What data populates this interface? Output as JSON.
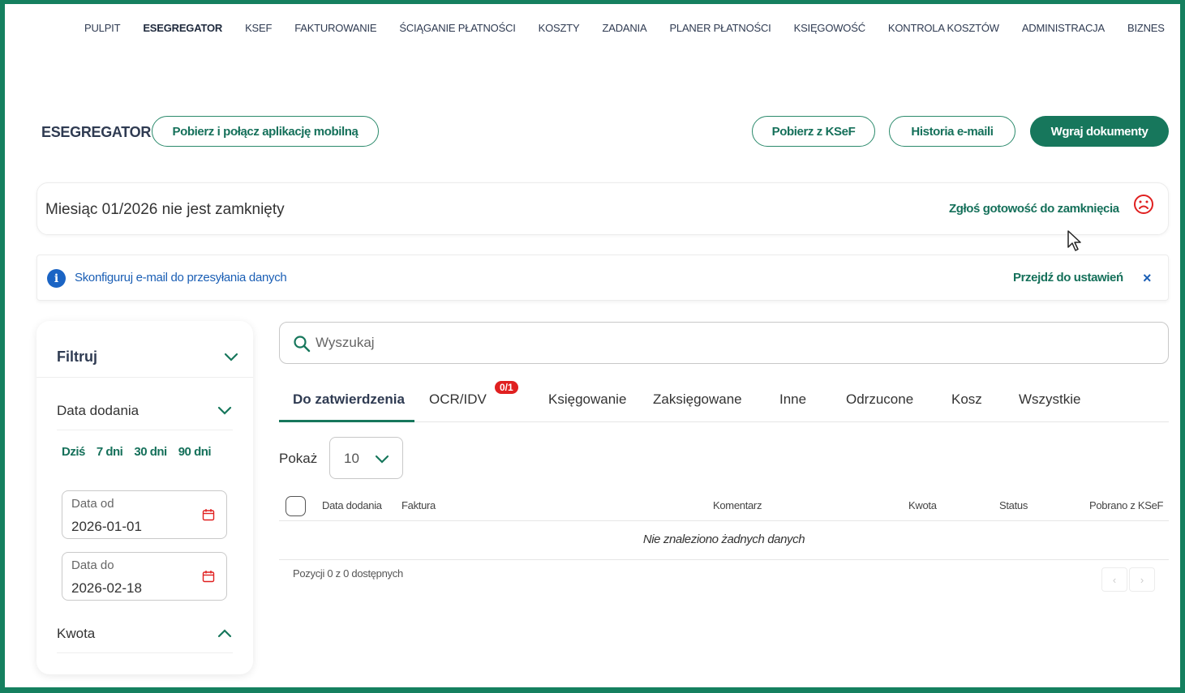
{
  "nav": {
    "items": [
      {
        "label": "PULPIT",
        "active": false
      },
      {
        "label": "ESEGREGATOR",
        "active": true
      },
      {
        "label": "KSEF",
        "active": false
      },
      {
        "label": "FAKTUROWANIE",
        "active": false
      },
      {
        "label": "ŚCIĄGANIE PŁATNOŚCI",
        "active": false
      },
      {
        "label": "KOSZTY",
        "active": false
      },
      {
        "label": "ZADANIA",
        "active": false
      },
      {
        "label": "PLANER PŁATNOŚCI",
        "active": false
      },
      {
        "label": "KSIĘGOWOŚĆ",
        "active": false
      },
      {
        "label": "KONTROLA KOSZTÓW",
        "active": false
      },
      {
        "label": "ADMINISTRACJA",
        "active": false
      },
      {
        "label": "BIZNES",
        "active": false
      }
    ]
  },
  "header": {
    "title": "ESEGREGATOR",
    "mobile_app_button": "Pobierz i połącz aplikację mobilną",
    "ksef_button": "Pobierz z KSeF",
    "email_history_button": "Historia e-maili",
    "upload_button": "Wgraj dokumenty"
  },
  "month_banner": {
    "text": "Miesiąc 01/2026 nie jest zamknięty",
    "ready_link": "Zgłoś gotowość do zamknięcia",
    "status_icon": "sad-face-icon",
    "status_color": "#e02020"
  },
  "info_banner": {
    "text": "Skonfiguruj e-mail do przesyłania danych",
    "settings_link": "Przejdź do ustawień",
    "close_label": "×"
  },
  "filter": {
    "title": "Filtruj",
    "date_section": "Data dodania",
    "quick_ranges": [
      "Dziś",
      "7 dni",
      "30 dni",
      "90 dni"
    ],
    "date_from_label": "Data od",
    "date_from_value": "2026-01-01",
    "date_to_label": "Data do",
    "date_to_value": "2026-02-18",
    "amount_section": "Kwota"
  },
  "search": {
    "placeholder": "Wyszukaj"
  },
  "tabs": {
    "items": [
      {
        "label": "Do zatwierdzenia",
        "active": true
      },
      {
        "label": "OCR/IDV",
        "active": false
      },
      {
        "label": "Księgowanie",
        "active": false
      },
      {
        "label": "Zaksięgowane",
        "active": false
      },
      {
        "label": "Inne",
        "active": false
      },
      {
        "label": "Odrzucone",
        "active": false
      },
      {
        "label": "Kosz",
        "active": false
      },
      {
        "label": "Wszystkie",
        "active": false
      }
    ],
    "ocr_badge": "0/1"
  },
  "show": {
    "label": "Pokaż",
    "value": "10"
  },
  "table": {
    "columns": [
      "Data dodania",
      "Faktura",
      "Komentarz",
      "Kwota",
      "Status",
      "Pobrano z KSeF"
    ],
    "empty_message": "Nie znaleziono żadnych danych",
    "positions_text": "Pozycji 0 z 0 dostępnych",
    "prev_label": "‹",
    "next_label": "›"
  },
  "colors": {
    "accent": "#17775c",
    "frame": "#15805f",
    "info": "#1b64c4",
    "badge": "#e02020"
  }
}
